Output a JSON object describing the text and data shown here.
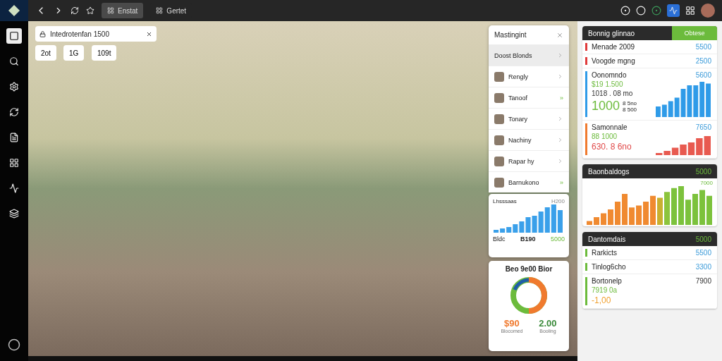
{
  "topbar": {
    "tabs": [
      {
        "label": "Enstat",
        "selected": true
      },
      {
        "label": "Gertet",
        "selected": false
      }
    ]
  },
  "sidebar": {
    "items": [
      {
        "selected": true
      },
      {
        "selected": false
      },
      {
        "selected": false
      },
      {
        "selected": false
      },
      {
        "selected": false
      },
      {
        "selected": false
      },
      {
        "selected": false
      },
      {
        "selected": false
      }
    ]
  },
  "search": {
    "value": "Intedrotenfan 1500",
    "chips": [
      "2ot",
      "1G",
      "109t"
    ]
  },
  "list_panel": {
    "title": "Mastingint",
    "items": [
      {
        "label": "Doost Blonds",
        "selected": true
      },
      {
        "label": "Rengly",
        "selected": false
      },
      {
        "label": "Tanoof",
        "selected": false,
        "badge": "»"
      },
      {
        "label": "Tonary",
        "selected": false
      },
      {
        "label": "Nachiny",
        "selected": false
      },
      {
        "label": "Rapar hy",
        "selected": false
      },
      {
        "label": "Barnukono",
        "selected": false,
        "badge": "»"
      }
    ]
  },
  "trend_card": {
    "title": "Lhsssaas",
    "reading": "H200",
    "footer": [
      "Bldc",
      "B190",
      "5000"
    ]
  },
  "donut_card": {
    "title": "Beo 9e00 Bior",
    "stats": [
      {
        "value": "$90",
        "label": "Blocomed",
        "color": "#f07a2e"
      },
      {
        "value": "2.00",
        "label": "Booling",
        "color": "#3a8a3a"
      }
    ]
  },
  "summary_card": {
    "title": "Bonnig glinnao",
    "action": "Obtese",
    "rows": [
      {
        "kind": "row",
        "label": "Menade 2009",
        "value": "5500",
        "color": "#e03a3a"
      },
      {
        "kind": "row",
        "label": "Voogde mgng",
        "value": "2500",
        "color": "#e03a3a"
      },
      {
        "kind": "metric",
        "label": "Oonomndo",
        "value": "5600",
        "color": "#2f9be8",
        "lines": [
          "$19 1.500",
          "1018 . 08 mo"
        ],
        "big": "1000",
        "small": [
          "8 5no",
          "8 500"
        ]
      },
      {
        "kind": "metric",
        "label": "Samonnale",
        "value": "7650",
        "color": "#f07a2e",
        "lines": [
          "88 1000"
        ],
        "big": "630. 8 6no",
        "small": []
      }
    ]
  },
  "bars_card": {
    "title": "Baonbaldogs",
    "reading": "5000",
    "peak": "7000"
  },
  "detail_card": {
    "title": "Dantomdais",
    "reading": "5000",
    "rows": [
      {
        "kind": "row",
        "label": "Rarkicts",
        "value": "5500",
        "color": "#6cbb3c"
      },
      {
        "kind": "row",
        "label": "Tinlog6cho",
        "value": "3300",
        "color": "#6cbb3c"
      },
      {
        "kind": "metric",
        "label": "Bortonelp",
        "value": "7900",
        "color": "#6cbb3c",
        "lines": [
          "7919 0a"
        ],
        "big": "-1,00",
        "small": []
      }
    ]
  }
}
